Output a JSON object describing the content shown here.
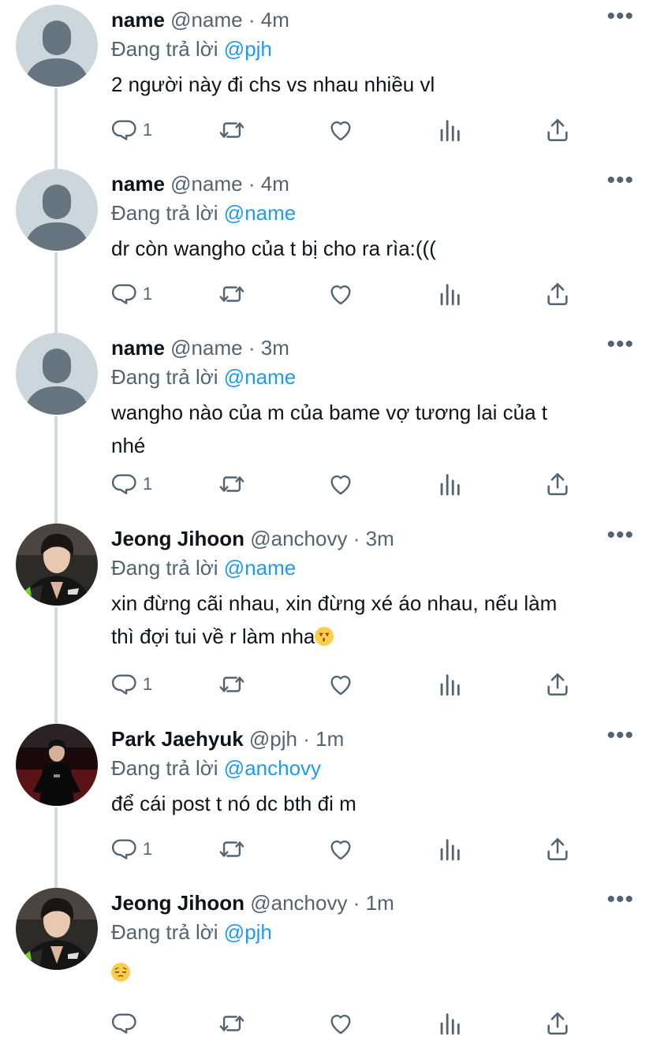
{
  "replying_prefix": "Đang trả lời",
  "more_glyph": "•••",
  "colors": {
    "mention": "#1d9bf0",
    "secondary": "#536471",
    "thread_line": "#cfd9de",
    "placeholder_avatar": "#ccd6dd"
  },
  "tweets": [
    {
      "name": "name",
      "handle": "@name",
      "time": "4m",
      "reply_to": "@pjh",
      "text": "2 người này đi chs vs nhau nhiều vl",
      "reply_count": "1",
      "avatar": "placeholder"
    },
    {
      "name": "name",
      "handle": "@name",
      "time": "4m",
      "reply_to": "@name",
      "text": "dr còn wangho của t bị cho ra rìa:(((",
      "reply_count": "1",
      "avatar": "placeholder"
    },
    {
      "name": "name",
      "handle": "@name",
      "time": "3m",
      "reply_to": "@name",
      "text_lines": [
        "wangho nào của m của bame vợ tương lai của t",
        "nhé"
      ],
      "reply_count": "1",
      "avatar": "placeholder"
    },
    {
      "name": "Jeong Jihoon",
      "handle": "@anchovy",
      "time": "3m",
      "reply_to": "@name",
      "text_lines": [
        "xin đừng cãi nhau, xin đừng xé áo nhau, nếu làm",
        "thì đợi tui về r làm nha"
      ],
      "reply_count": "1",
      "avatar": "photo-jihoon"
    },
    {
      "name": "Park Jaehyuk",
      "handle": "@pjh",
      "time": "1m",
      "reply_to": "@anchovy",
      "text": "để cái post t nó dc bth đi m",
      "reply_count": "1",
      "avatar": "photo-jaehyuk"
    },
    {
      "name": "Jeong Jihoon",
      "handle": "@anchovy",
      "time": "1m",
      "reply_to": "@pjh",
      "text": "",
      "reply_count": "",
      "avatar": "photo-jihoon"
    }
  ],
  "emojis": {
    "kissing": "kissing-face-emoji",
    "pensive": "pensive-face-emoji"
  },
  "icons": [
    "reply-icon",
    "retweet-icon",
    "like-icon",
    "analytics-icon",
    "share-icon",
    "more-icon"
  ]
}
